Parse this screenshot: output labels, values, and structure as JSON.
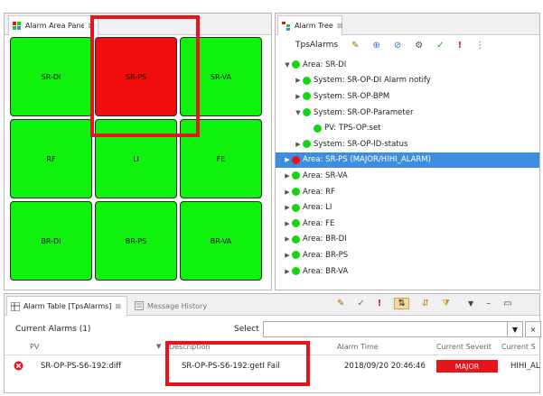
{
  "area_pane": {
    "tab_label": "Alarm Area Panel",
    "close_glyph": "⊠",
    "cells": [
      {
        "label": "SR-DI",
        "status": "ok"
      },
      {
        "label": "SR-PS",
        "status": "alarm"
      },
      {
        "label": "SR-VA",
        "status": "ok"
      },
      {
        "label": "RF",
        "status": "ok"
      },
      {
        "label": "LI",
        "status": "ok"
      },
      {
        "label": "FE",
        "status": "ok"
      },
      {
        "label": "BR-DI",
        "status": "ok"
      },
      {
        "label": "BR-PS",
        "status": "ok"
      },
      {
        "label": "BR-VA",
        "status": "ok"
      }
    ]
  },
  "tree_pane": {
    "tab_label": "Alarm Tree",
    "close_glyph": "⊠",
    "toolbar": {
      "dropdown_label": "TpsAlarms"
    },
    "rows": [
      {
        "label": "Area: SR-DI",
        "expanded": true
      },
      {
        "label": "System: SR-OP-DI Alarm notify",
        "expanded": false
      },
      {
        "label": "System: SR-OP-BPM",
        "expanded": false
      },
      {
        "label": "System: SR-OP-Parameter",
        "expanded": true
      },
      {
        "label": "PV: TPS-OP:set",
        "expanded": null
      },
      {
        "label": "System: SR-OP-ID-status",
        "expanded": false
      },
      {
        "label": "Area: SR-PS (MAJOR/HIHI_ALARM)",
        "expanded": false,
        "status": "alarm"
      },
      {
        "label": "Area: SR-VA",
        "expanded": false
      },
      {
        "label": "Area: RF",
        "expanded": false
      },
      {
        "label": "Area: LI",
        "expanded": false
      },
      {
        "label": "Area: FE",
        "expanded": false
      },
      {
        "label": "Area: BR-DI",
        "expanded": false
      },
      {
        "label": "Area: BR-PS",
        "expanded": false
      },
      {
        "label": "Area: BR-VA",
        "expanded": false
      }
    ]
  },
  "table_pane": {
    "tab_label": "Alarm Table [TpsAlarms]",
    "tab_close": "⊠",
    "history_tab_label": "Message History",
    "current_alarms_label": "Current Alarms (1)",
    "select_label": "Select",
    "columns": {
      "pv": "PV",
      "description": "Description",
      "alarm_time": "Alarm Time",
      "current_severity": "Current Severit",
      "current_status": "Current S"
    },
    "rows": [
      {
        "pv": "SR-OP-PS-S6-192:diff",
        "description": "SR-OP-PS-S6-192:getI Fail",
        "alarm_time": "2018/09/20 20:46:46",
        "severity": "MAJOR",
        "status": "HIHI_AL"
      }
    ]
  },
  "colors": {
    "ok": "#0ef20e",
    "alarm": "#f20d0d",
    "highlight": "#e8141b",
    "selection": "#3d8ee1"
  }
}
